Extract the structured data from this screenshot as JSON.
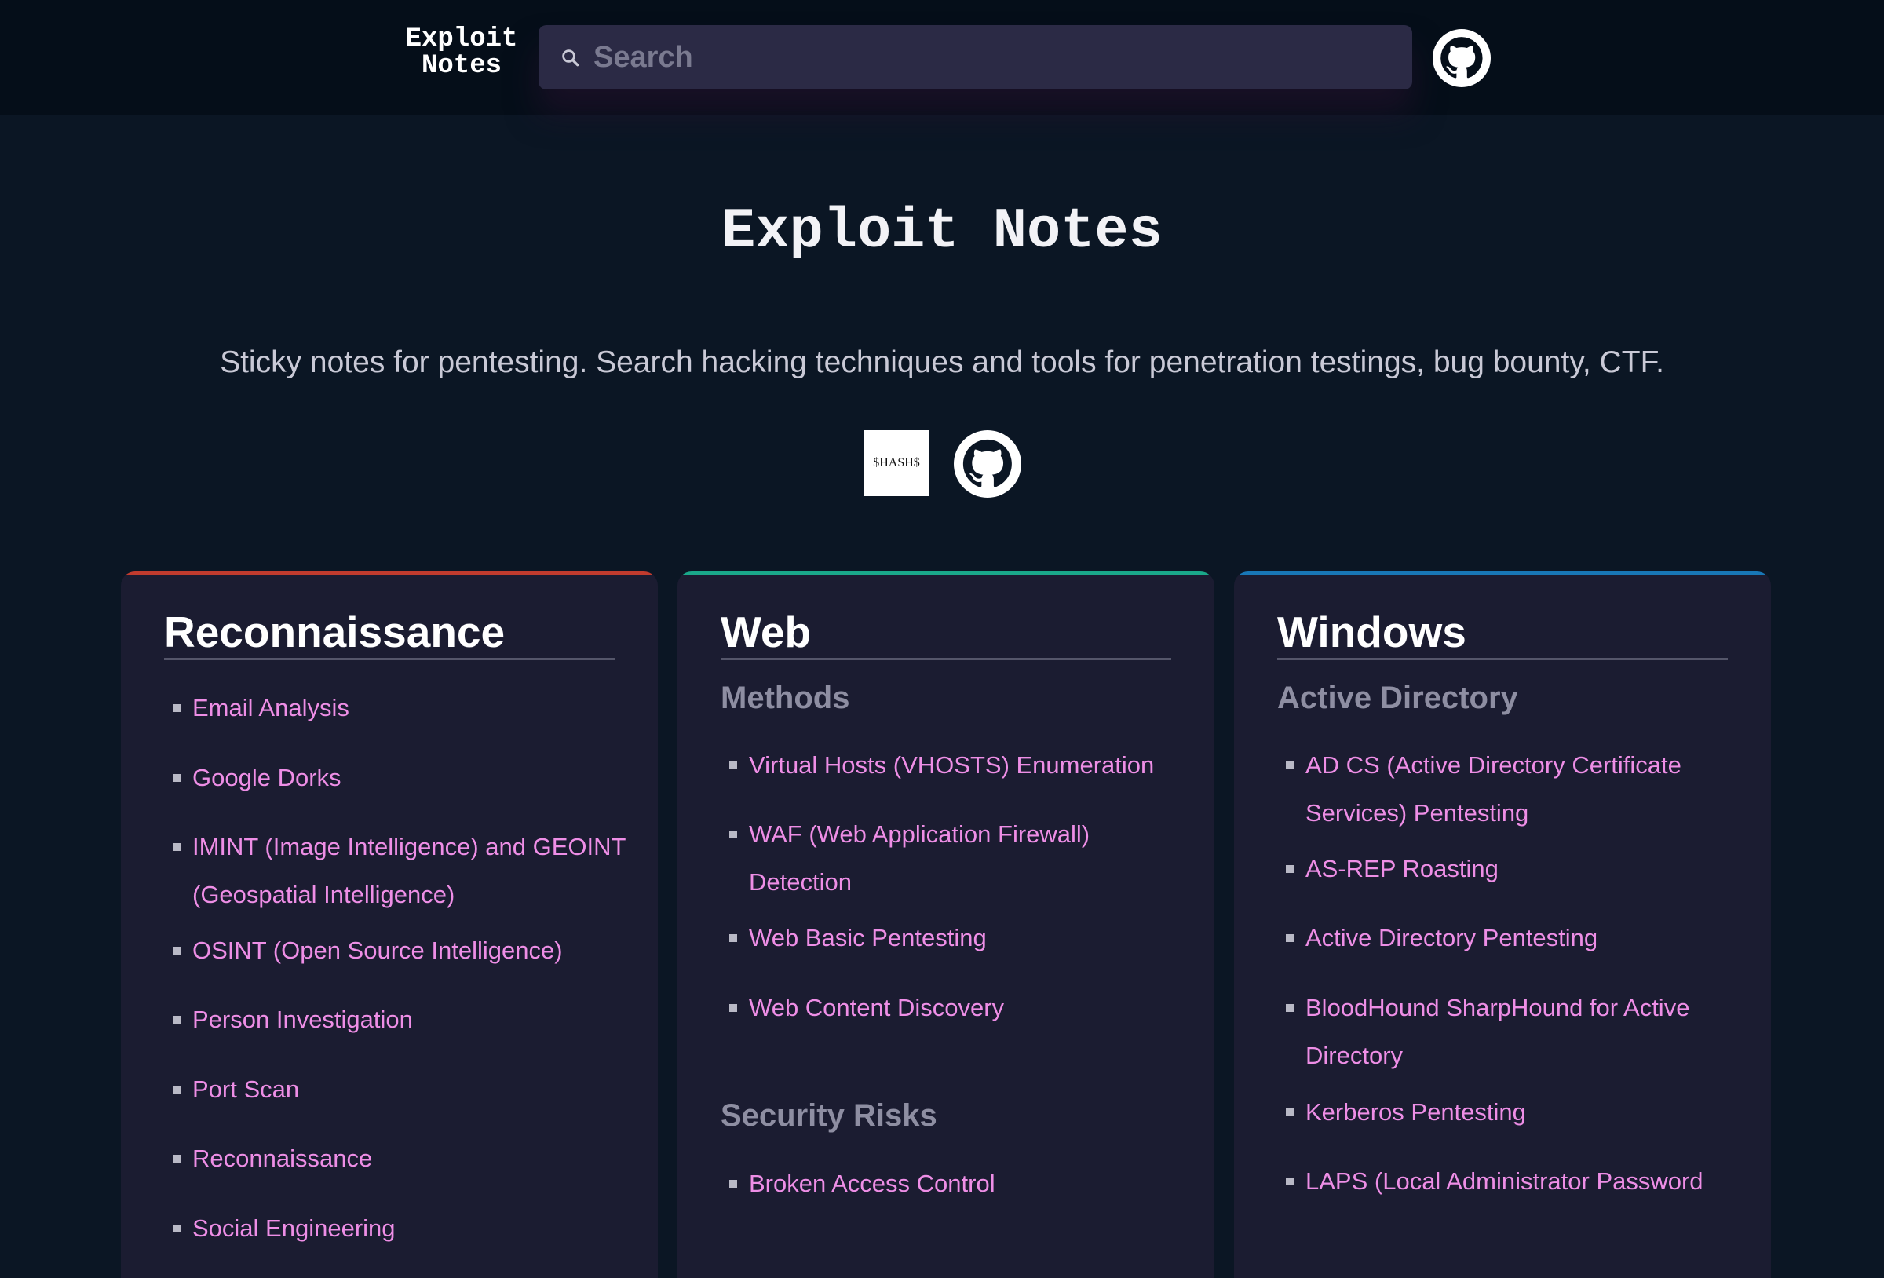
{
  "header": {
    "logo_line1": "Exploit",
    "logo_line2": "Notes",
    "search_placeholder": "Search"
  },
  "hero": {
    "title": "Exploit Notes",
    "subtitle": "Sticky notes for pentesting. Search hacking techniques and tools for penetration testings, bug bounty, CTF.",
    "badge_text": "$HASH$"
  },
  "cards": [
    {
      "title": "Reconnaissance",
      "accent": "#c13b2e",
      "items": [
        "Email Analysis",
        "Google Dorks",
        "IMINT (Image Intelligence) and GEOINT (Geospatial Intelligence)",
        "OSINT (Open Source Intelligence)",
        "Person Investigation",
        "Port Scan",
        "Reconnaissance",
        "Social Engineering"
      ]
    },
    {
      "title": "Web",
      "accent": "#1aa88a",
      "sections": [
        {
          "heading": "Methods",
          "items": [
            "Virtual Hosts (VHOSTS) Enumeration",
            "WAF (Web Application Firewall) Detection",
            "Web Basic Pentesting",
            "Web Content Discovery"
          ]
        },
        {
          "heading": "Security Risks",
          "items": [
            "Broken Access Control"
          ]
        }
      ]
    },
    {
      "title": "Windows",
      "accent": "#1877b6",
      "sections": [
        {
          "heading": "Active Directory",
          "items": [
            "AD CS (Active Directory Certificate Services) Pentesting",
            "AS-REP Roasting",
            "Active Directory Pentesting",
            "BloodHound SharpHound for Active Directory",
            "Kerberos Pentesting",
            "LAPS (Local Administrator Password"
          ]
        }
      ]
    }
  ],
  "colors": {
    "background": "#0b1624",
    "header": "#050e19",
    "card": "#1b1c31",
    "link": "#ee8ee6",
    "subheading": "#8e8ea2"
  }
}
